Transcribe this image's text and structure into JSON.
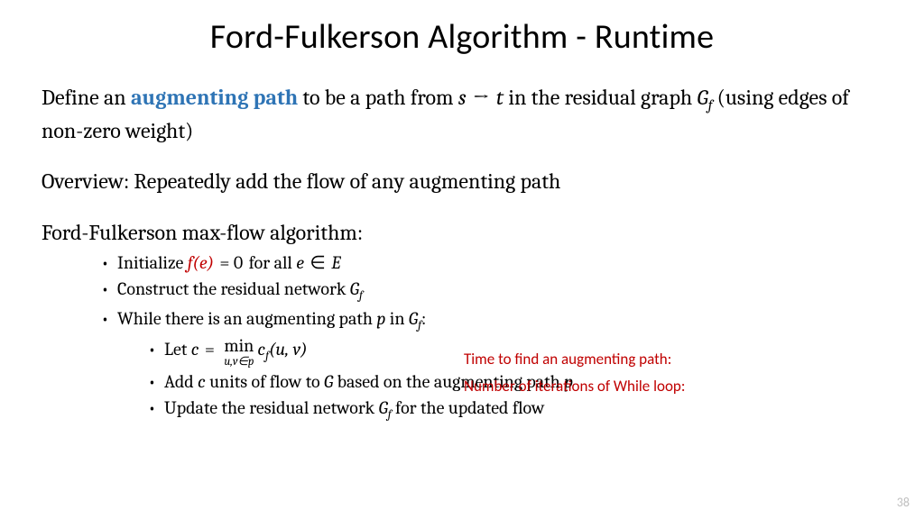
{
  "title": "Ford-Fulkerson Algorithm - Runtime",
  "def": {
    "pre": "Define an ",
    "term": "augmenting path",
    "post1": " to be a path from ",
    "math_s": "s",
    "arrow": " → ",
    "math_t": "t",
    "post2": " in the residual graph ",
    "gf_g": "G",
    "gf_f": "f",
    "post3": "  (using edges of non-zero weight)"
  },
  "overview": "Overview: Repeatedly add the flow of any augmenting path",
  "algo_heading": "Ford-Fulkerson max-flow algorithm:",
  "b1": {
    "pre": "Initialize ",
    "fe": "f(e)",
    "eq": " = 0",
    "mid": " for all ",
    "e": "e",
    "in": " ∈ ",
    "E": "E"
  },
  "b2": {
    "pre": "Construct the residual network ",
    "gf_g": "G",
    "gf_f": "f"
  },
  "b3": {
    "pre": "While there is an augmenting path ",
    "p": "p",
    "mid": " in ",
    "gf_g": "G",
    "gf_f": "f",
    "colon": ":"
  },
  "b3a": {
    "pre": "Let ",
    "c": "c",
    "eq": " = ",
    "min": "min",
    "under": "u,v∈p",
    "cf": "c",
    "cf_f": "f",
    "uv": "(u, v)"
  },
  "b3b": {
    "pre": "Add ",
    "c": "c",
    "mid1": " units of flow to ",
    "G": "G",
    "mid2": " based on the augmenting path ",
    "p": "p"
  },
  "b3c": {
    "pre": "Update the residual network ",
    "gf_g": "G",
    "gf_f": "f",
    "post": " for the updated flow"
  },
  "annot1": "Time to find an augmenting path:",
  "annot2": "Number of iterations of While loop:",
  "pagenum": "38"
}
